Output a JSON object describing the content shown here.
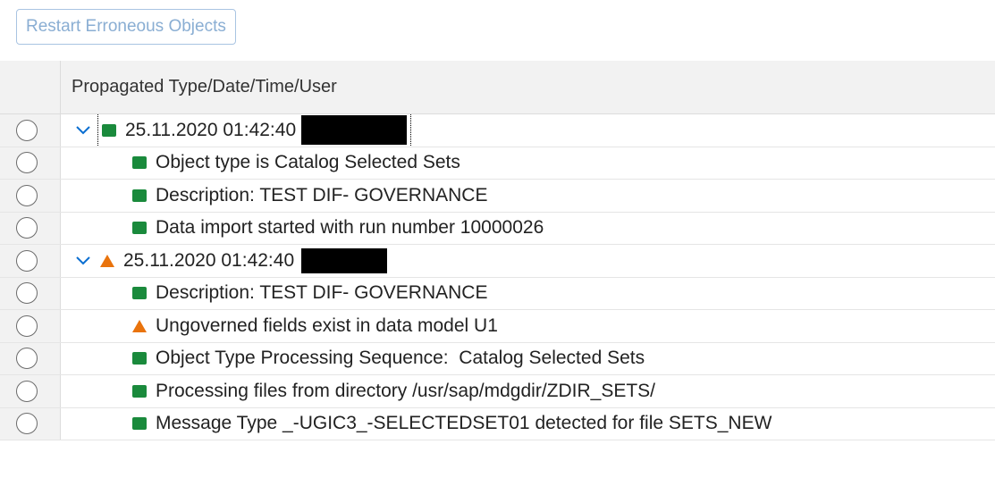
{
  "toolbar": {
    "restart_label": "Restart Erroneous Objects"
  },
  "table": {
    "header": "Propagated Type/Date/Time/User",
    "rows": [
      {
        "level": 1,
        "status": "success",
        "expanded": true,
        "text": "25.11.2020 01:42:40",
        "redacted": true
      },
      {
        "level": 2,
        "status": "success",
        "text": "Object type is Catalog Selected Sets"
      },
      {
        "level": 2,
        "status": "success",
        "text": "Description: TEST DIF- GOVERNANCE"
      },
      {
        "level": 2,
        "status": "success",
        "text": "Data import started with run number 10000026"
      },
      {
        "level": 1,
        "status": "warning",
        "expanded": true,
        "text": "25.11.2020 01:42:40",
        "redacted": true
      },
      {
        "level": 2,
        "status": "success",
        "text": "Description: TEST DIF- GOVERNANCE"
      },
      {
        "level": 2,
        "status": "warning",
        "text": "Ungoverned fields exist in data model U1"
      },
      {
        "level": 2,
        "status": "success",
        "text": "Object Type Processing Sequence:  Catalog Selected Sets"
      },
      {
        "level": 2,
        "status": "success",
        "text": "Processing files from directory /usr/sap/mdgdir/ZDIR_SETS/"
      },
      {
        "level": 2,
        "status": "success",
        "text": "Message Type _-UGIC3_-SELECTEDSET01 detected for file SETS_NEW"
      }
    ]
  },
  "colors": {
    "success": "#1a8a3c",
    "warning": "#e9730c",
    "chevron": "#0a6ed1",
    "button_text": "#8aaed3"
  },
  "icons": {
    "success": "green-square-icon",
    "warning": "warning-triangle-icon",
    "expand": "chevron-down-icon"
  }
}
